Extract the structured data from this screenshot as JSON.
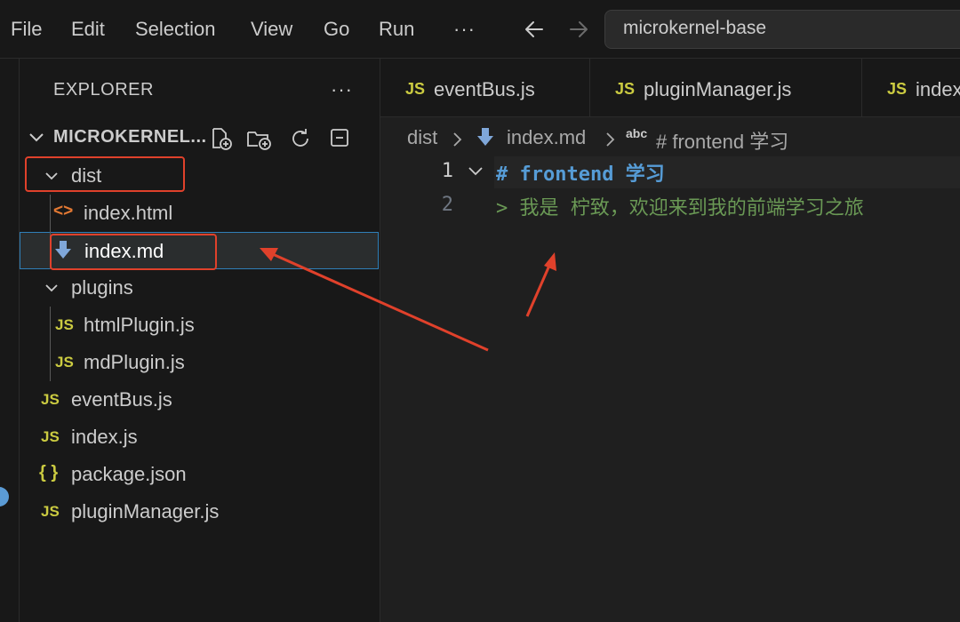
{
  "menu": {
    "items": [
      "File",
      "Edit",
      "Selection",
      "View",
      "Go",
      "Run"
    ],
    "more": "···"
  },
  "search": {
    "text": "microkernel-base"
  },
  "sidebar": {
    "title": "EXPLORER",
    "more": "···",
    "section_title": "MICROKERNEL...",
    "tree": [
      {
        "label": "dist",
        "type": "folder"
      },
      {
        "label": "index.html",
        "type": "html"
      },
      {
        "label": "index.md",
        "type": "md"
      },
      {
        "label": "plugins",
        "type": "folder"
      },
      {
        "label": "htmlPlugin.js",
        "type": "js"
      },
      {
        "label": "mdPlugin.js",
        "type": "js"
      },
      {
        "label": "eventBus.js",
        "type": "js"
      },
      {
        "label": "index.js",
        "type": "js"
      },
      {
        "label": "package.json",
        "type": "json"
      },
      {
        "label": "pluginManager.js",
        "type": "js"
      }
    ],
    "js_badge": "JS",
    "json_badge": "{ }",
    "html_badge": "<>"
  },
  "tabs": [
    {
      "label": "eventBus.js"
    },
    {
      "label": "pluginManager.js"
    },
    {
      "label": "index.js"
    }
  ],
  "breadcrumb": {
    "folder": "dist",
    "file": "index.md",
    "symbol_badge": "abc",
    "symbol": "# frontend 学习"
  },
  "editor": {
    "lines": [
      {
        "number": "1",
        "marker": "#",
        "text": "frontend 学习"
      },
      {
        "number": "2",
        "marker": ">",
        "text": "我是 柠致，欢迎来到我的前端学习之旅"
      }
    ]
  },
  "colors": {
    "accent": "#2f7fb8",
    "annotation_red": "#e0412b",
    "js_yellow": "#cbcb41",
    "markdown_heading": "#569cd6",
    "quote_green": "#6a9955"
  }
}
